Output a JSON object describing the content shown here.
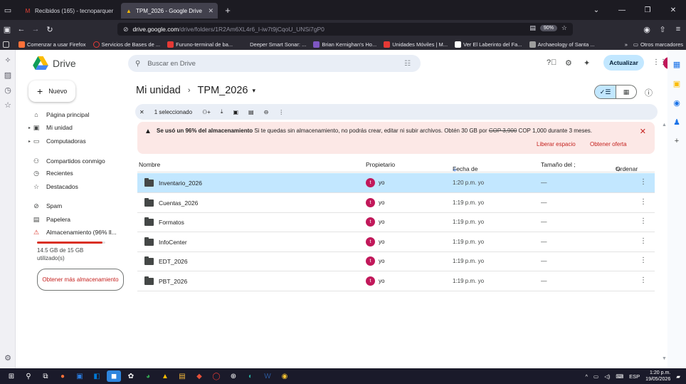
{
  "browser": {
    "tabs": [
      {
        "label": "Recibidos (165) - tecnoparquer",
        "active": false
      },
      {
        "label": "TPM_2026 - Google Drive",
        "active": true
      }
    ],
    "url_host": "drive.google.com",
    "url_path": "/drive/folders/1R2Am6XL4r6_I-iw7t9jCqoU_UNSi7gP0",
    "zoom": "90%",
    "bookmarks": [
      "Comenzar a usar Firefox",
      "Servicios de Bases de ...",
      "Furuno-terminal de ba...",
      "Deeper Smart Sonar: ...",
      "Brian Kernighan's Ho...",
      "Unidades Móviles | M...",
      "Ver El Laberinto del Fa...",
      "Archaeology of Santa ..."
    ],
    "other_bookmarks": "Otros marcadores"
  },
  "drive": {
    "logo_text": "Drive",
    "search_placeholder": "Buscar en Drive",
    "upgrade_label": "Actualizar",
    "avatar_letter": "t",
    "new_label": "Nuevo",
    "nav": [
      {
        "label": "Página principal",
        "icon": "home-icon"
      },
      {
        "label": "Mi unidad",
        "icon": "drive-icon"
      },
      {
        "label": "Computadoras",
        "icon": "computer-icon"
      },
      {
        "label": "Compartidos conmigo",
        "icon": "people-icon"
      },
      {
        "label": "Recientes",
        "icon": "clock-icon"
      },
      {
        "label": "Destacados",
        "icon": "star-icon"
      },
      {
        "label": "Spam",
        "icon": "spam-icon"
      },
      {
        "label": "Papelera",
        "icon": "trash-icon"
      },
      {
        "label": "Almacenamiento (96% ll...",
        "icon": "warning-icon"
      }
    ],
    "storage_used_fraction": 0.96,
    "storage_text": "14.5 GB de 15 GB utilizado(s)",
    "more_storage_label": "Obtener más almacenamiento"
  },
  "main": {
    "breadcrumb_root": "Mi unidad",
    "breadcrumb_current": "TPM_2026",
    "selection_text": "1 seleccionado",
    "warning": {
      "bold": "Se usó un 96% del almacenamiento",
      "text": " Si te quedas sin almacenamiento, no podrás crear, editar ni subir archivos. Obtén 30 GB por ",
      "old_price": "COP 3,900",
      "text2": " COP 1,000 durante 3 meses.",
      "link1": "Liberar espacio",
      "link2": "Obtener oferta"
    },
    "columns": {
      "name": "Nombre",
      "owner": "Propietario",
      "modified": "Fecha de modificación",
      "size": "Tamaño del ;",
      "sort": "Ordenar"
    },
    "files": [
      {
        "name": "Inventario_2026",
        "owner": "yo",
        "modified": "1:20 p.m. yo",
        "size": "—",
        "selected": true
      },
      {
        "name": "Cuentas_2026",
        "owner": "yo",
        "modified": "1:19 p.m. yo",
        "size": "—",
        "selected": false
      },
      {
        "name": "Formatos",
        "owner": "yo",
        "modified": "1:19 p.m. yo",
        "size": "—",
        "selected": false
      },
      {
        "name": "InfoCenter",
        "owner": "yo",
        "modified": "1:19 p.m. yo",
        "size": "—",
        "selected": false
      },
      {
        "name": "EDT_2026",
        "owner": "yo",
        "modified": "1:19 p.m. yo",
        "size": "—",
        "selected": false
      },
      {
        "name": "PBT_2026",
        "owner": "yo",
        "modified": "1:19 p.m. yo",
        "size": "—",
        "selected": false
      }
    ]
  },
  "taskbar": {
    "lang": "ESP",
    "time": "1:20 p.m.",
    "date": "19/05/2026"
  }
}
